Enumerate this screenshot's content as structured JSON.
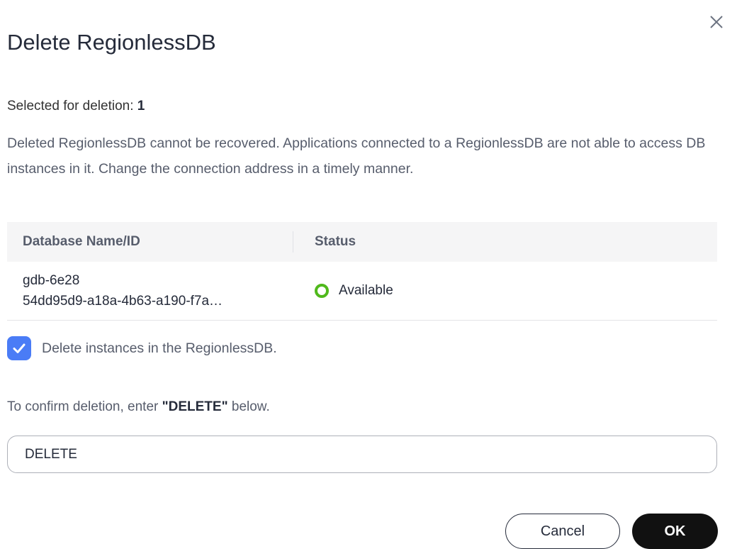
{
  "dialog": {
    "title": "Delete RegionlessDB",
    "selected_label": "Selected for deletion:",
    "selected_count": "1",
    "warning": "Deleted RegionlessDB cannot be recovered. Applications connected to a RegionlessDB are not able to access DB instances in it. Change the connection address in a timely manner."
  },
  "table": {
    "columns": [
      "Database Name/ID",
      "Status"
    ],
    "rows": [
      {
        "name": "gdb-6e28",
        "id": "54dd95d9-a18a-4b63-a190-f7a…",
        "status": "Available",
        "status_color": "#50b91c"
      }
    ]
  },
  "checkbox": {
    "label": "Delete instances in the RegionlessDB.",
    "checked": true,
    "color": "#4a7cf6"
  },
  "confirm": {
    "prefix": "To confirm deletion, enter ",
    "keyword": "\"DELETE\"",
    "suffix": " below.",
    "input_value": "DELETE"
  },
  "buttons": {
    "cancel": "Cancel",
    "ok": "OK"
  },
  "icons": {
    "close": "close-icon",
    "check": "check-icon"
  }
}
